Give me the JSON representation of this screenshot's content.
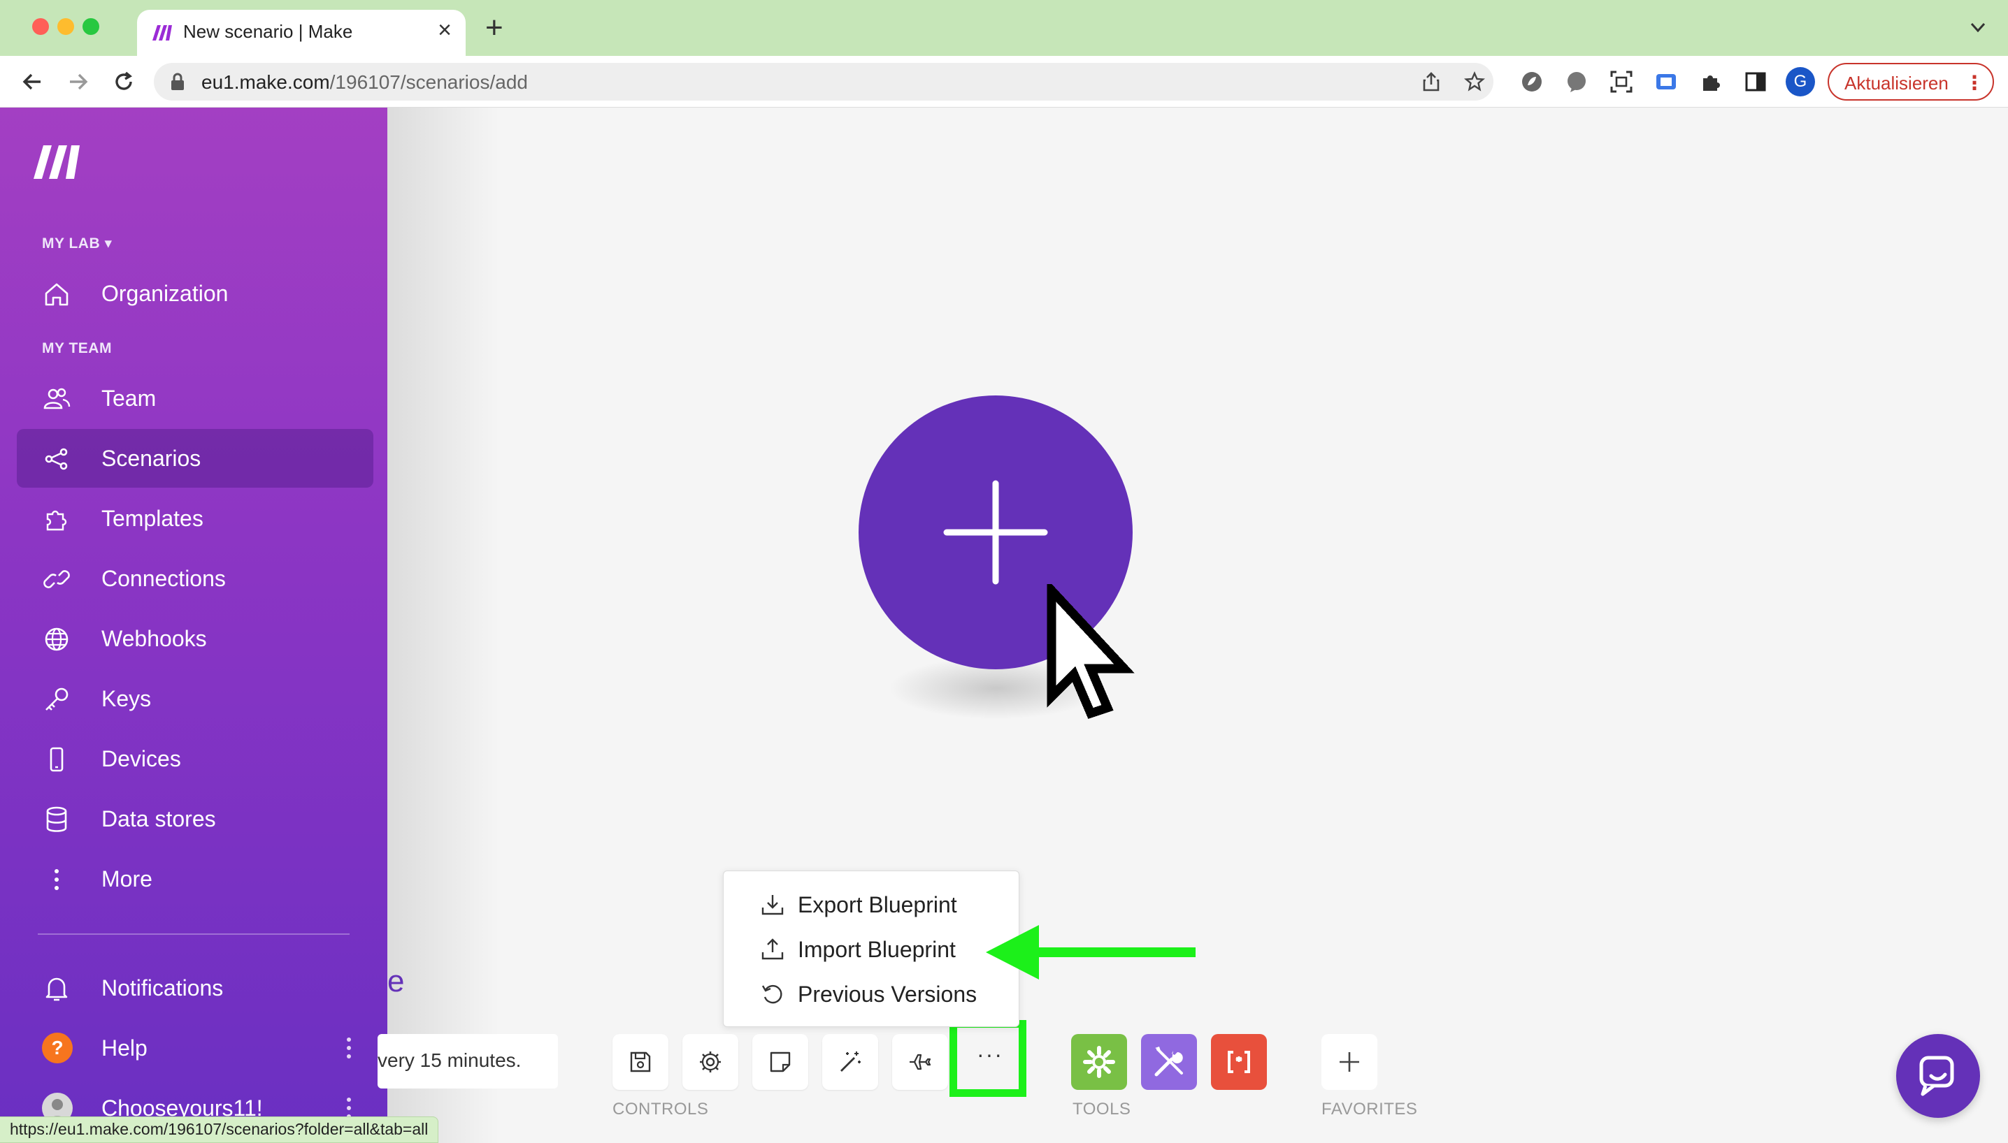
{
  "browser": {
    "tab_title": "New scenario | Make",
    "url_host": "eu1.make.com",
    "url_path": "/196107/scenarios/add",
    "profile_initial": "G",
    "update_label": "Aktualisieren"
  },
  "sidebar": {
    "org_section": "MY LAB ▾",
    "team_section": "MY TEAM",
    "items": [
      {
        "label": "Organization",
        "icon": "home-icon"
      },
      {
        "label": "Team",
        "icon": "users-icon"
      },
      {
        "label": "Scenarios",
        "icon": "share-icon",
        "active": true
      },
      {
        "label": "Templates",
        "icon": "puzzle-icon"
      },
      {
        "label": "Connections",
        "icon": "link-icon"
      },
      {
        "label": "Webhooks",
        "icon": "globe-icon"
      },
      {
        "label": "Keys",
        "icon": "key-icon"
      },
      {
        "label": "Devices",
        "icon": "phone-icon"
      },
      {
        "label": "Data stores",
        "icon": "database-icon"
      },
      {
        "label": "More",
        "icon": "vertical-dots-icon"
      }
    ],
    "bottom": [
      {
        "label": "Notifications",
        "icon": "bell-icon"
      },
      {
        "label": "Help",
        "icon": "help-icon"
      },
      {
        "label": "Chooseyours11!",
        "icon": "avatar"
      }
    ]
  },
  "canvas": {
    "partial_text": "e",
    "schedule_text": "very 15 minutes."
  },
  "menu": {
    "items": [
      {
        "label": "Export Blueprint",
        "icon": "download-icon"
      },
      {
        "label": "Import Blueprint",
        "icon": "upload-icon"
      },
      {
        "label": "Previous Versions",
        "icon": "history-icon"
      }
    ]
  },
  "bottom_bar": {
    "controls_label": "CONTROLS",
    "tools_label": "TOOLS",
    "favorites_label": "FAVORITES",
    "more_label": "···"
  },
  "status_bar_url": "https://eu1.make.com/196107/scenarios?folder=all&tab=all",
  "colors": {
    "sidebar_top": "#a33fc3",
    "sidebar_bottom": "#6a2fc2",
    "brand_purple": "#6431b8",
    "highlight_green": "#1cf01a",
    "tool_green": "#79c045",
    "tool_purple": "#9069e0",
    "tool_red": "#e8503c"
  }
}
